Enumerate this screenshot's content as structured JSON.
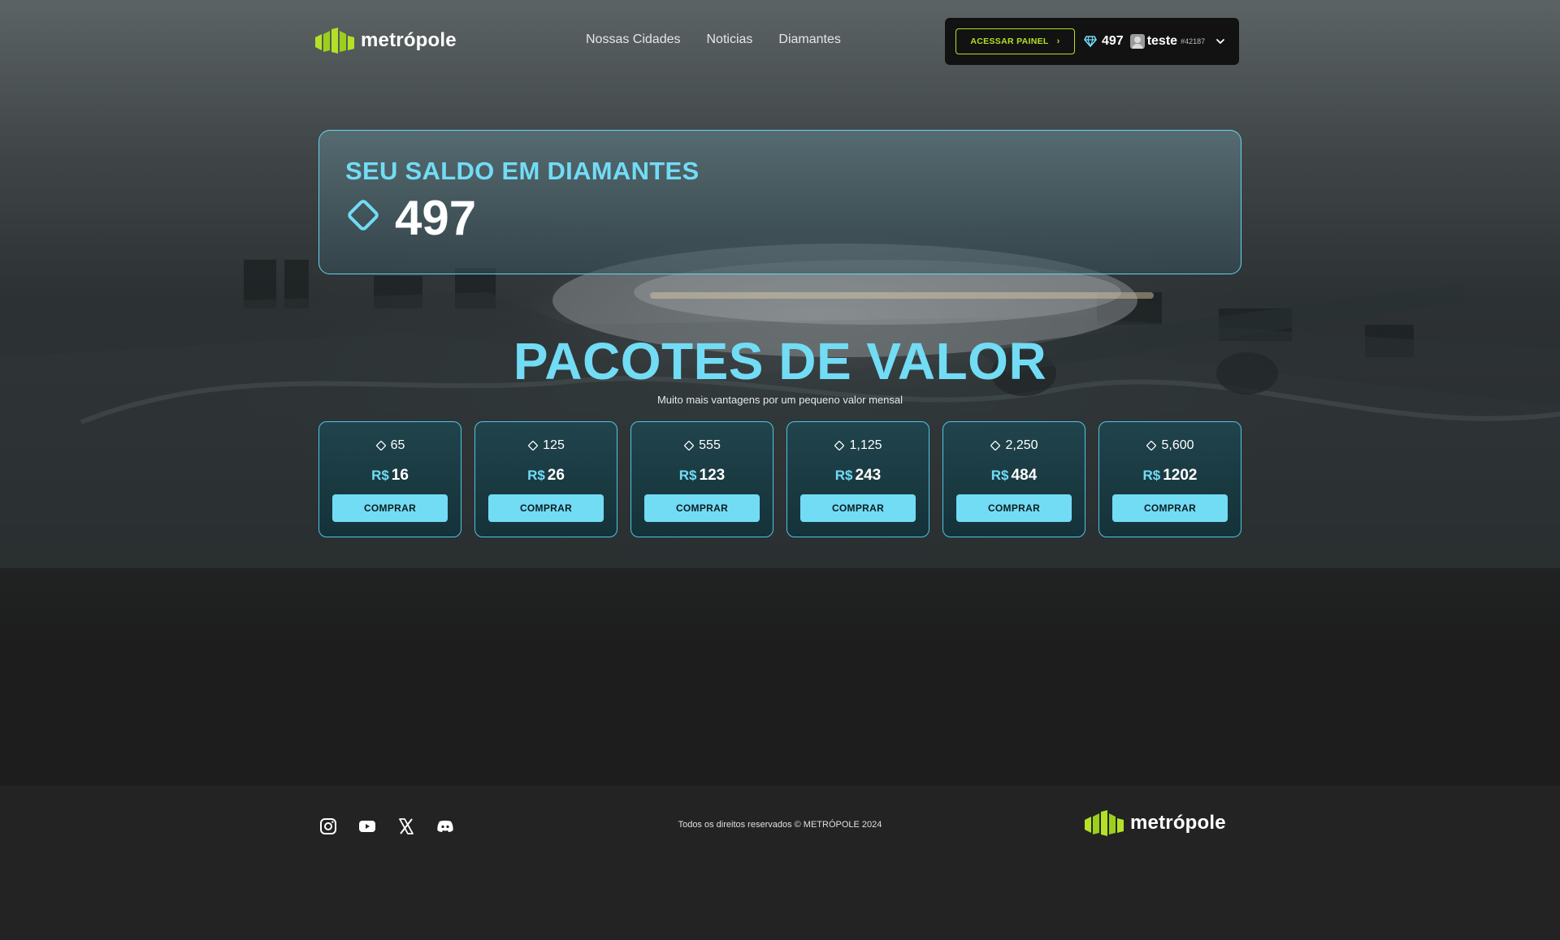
{
  "brand": {
    "name": "metrópole",
    "accent": "#b3e128",
    "primary": "#72dcf5"
  },
  "nav": {
    "items": [
      "Nossas Cidades",
      "Noticias",
      "Diamantes"
    ]
  },
  "user_panel": {
    "panel_button": "ACESSAR PAINEL",
    "diamonds": "497",
    "username": "teste",
    "user_id": "#42187"
  },
  "balance": {
    "title": "SEU SALDO EM DIAMANTES",
    "value": "497"
  },
  "packages": {
    "title": "PACOTES DE VALOR",
    "subtitle": "Muito mais vantagens por um pequeno valor mensal",
    "currency": "R$",
    "buy_label": "COMPRAR",
    "items": [
      {
        "diamonds": "65",
        "price": "16"
      },
      {
        "diamonds": "125",
        "price": "26"
      },
      {
        "diamonds": "555",
        "price": "123"
      },
      {
        "diamonds": "1,125",
        "price": "243"
      },
      {
        "diamonds": "2,250",
        "price": "484"
      },
      {
        "diamonds": "5,600",
        "price": "1202"
      }
    ]
  },
  "footer": {
    "socials": [
      "instagram-icon",
      "youtube-icon",
      "x-icon",
      "discord-icon"
    ],
    "copyright": "Todos os direitos reservados © METRÓPOLE 2024"
  }
}
